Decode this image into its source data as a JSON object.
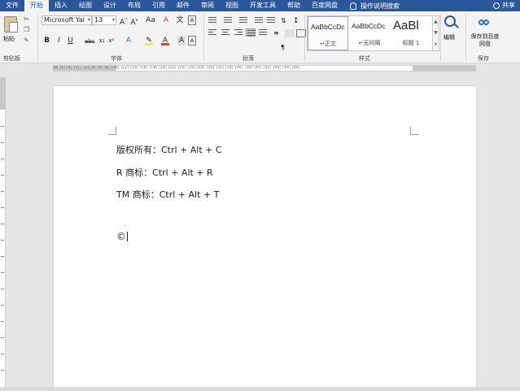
{
  "tabs": [
    "文件",
    "开始",
    "插入",
    "绘图",
    "设计",
    "布局",
    "引用",
    "邮件",
    "审阅",
    "视图",
    "开发工具",
    "帮助",
    "百度网盘"
  ],
  "active_tab_index": 1,
  "tell_me": "操作说明搜索",
  "share": "共享",
  "clipboard": {
    "paste": "粘贴",
    "group": "剪贴板"
  },
  "font": {
    "name": "Microsoft Yal",
    "size": "13",
    "group": "字体"
  },
  "paragraph": {
    "group": "段落"
  },
  "styles": {
    "group": "样式",
    "items": [
      {
        "sample": "AaBbCcDc",
        "name": "↵正文"
      },
      {
        "sample": "AaBbCcDc",
        "name": "↵无间隔"
      },
      {
        "sample": "AaBl",
        "name": "标题 1"
      }
    ]
  },
  "editing": {
    "label": "编辑"
  },
  "save": {
    "label": "保存到百度网盘",
    "group": "保存"
  },
  "ruler_ticks": "|8| |6| |4| |2| | |2| |4| |6| |8| |10| |12| |14| |16| |18| |20| |22| |24| |26| |28| |30| |32| |34| |36| |38| |40| |42| |44| |46| |48|",
  "document": {
    "lines": [
      "版权所有：Ctrl + Alt + C",
      "R 商标：Ctrl + Alt + R",
      "TM 商标：Ctrl + Alt + T"
    ],
    "symbol": "©"
  },
  "colors": {
    "accent": "#2b579a",
    "ribbon": "#f3f3f3",
    "canvas": "#e6e6e6"
  }
}
